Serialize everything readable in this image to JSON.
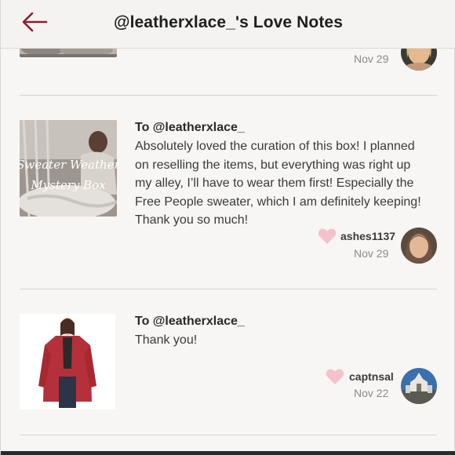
{
  "header": {
    "title": "@leatherxlace_'s Love Notes",
    "back_icon": "arrow-left-icon",
    "accent_color": "#8a1f2f"
  },
  "notes": [
    {
      "date": "Nov 29",
      "thumbnail_icon": "blanket-photo",
      "avatar_icon": "user-avatar-blonde"
    },
    {
      "recipient": "To @leatherxlace_",
      "message_lines": [
        "Absolutely loved the curation of this box! I planned",
        "on reselling the items, but everything was right up",
        "my alley, I’ll have to wear them first! Especially the",
        "Free People sweater, which I am definitely keeping!",
        "Thank you so much!"
      ],
      "thumbnail_text": [
        "Sweater Weather",
        "Mystery Box"
      ],
      "username": "ashes1137",
      "date": "Nov 29",
      "heart_color": "#f4c2cc",
      "avatar_icon": "user-avatar-brunette"
    },
    {
      "recipient": "To @leatherxlace_",
      "message_lines": [
        "Thank you!"
      ],
      "thumbnail_icon": "red-cardigan-photo",
      "username": "captnsal",
      "date": "Nov 22",
      "heart_color": "#f4c2cc",
      "avatar_icon": "user-avatar-building"
    }
  ]
}
